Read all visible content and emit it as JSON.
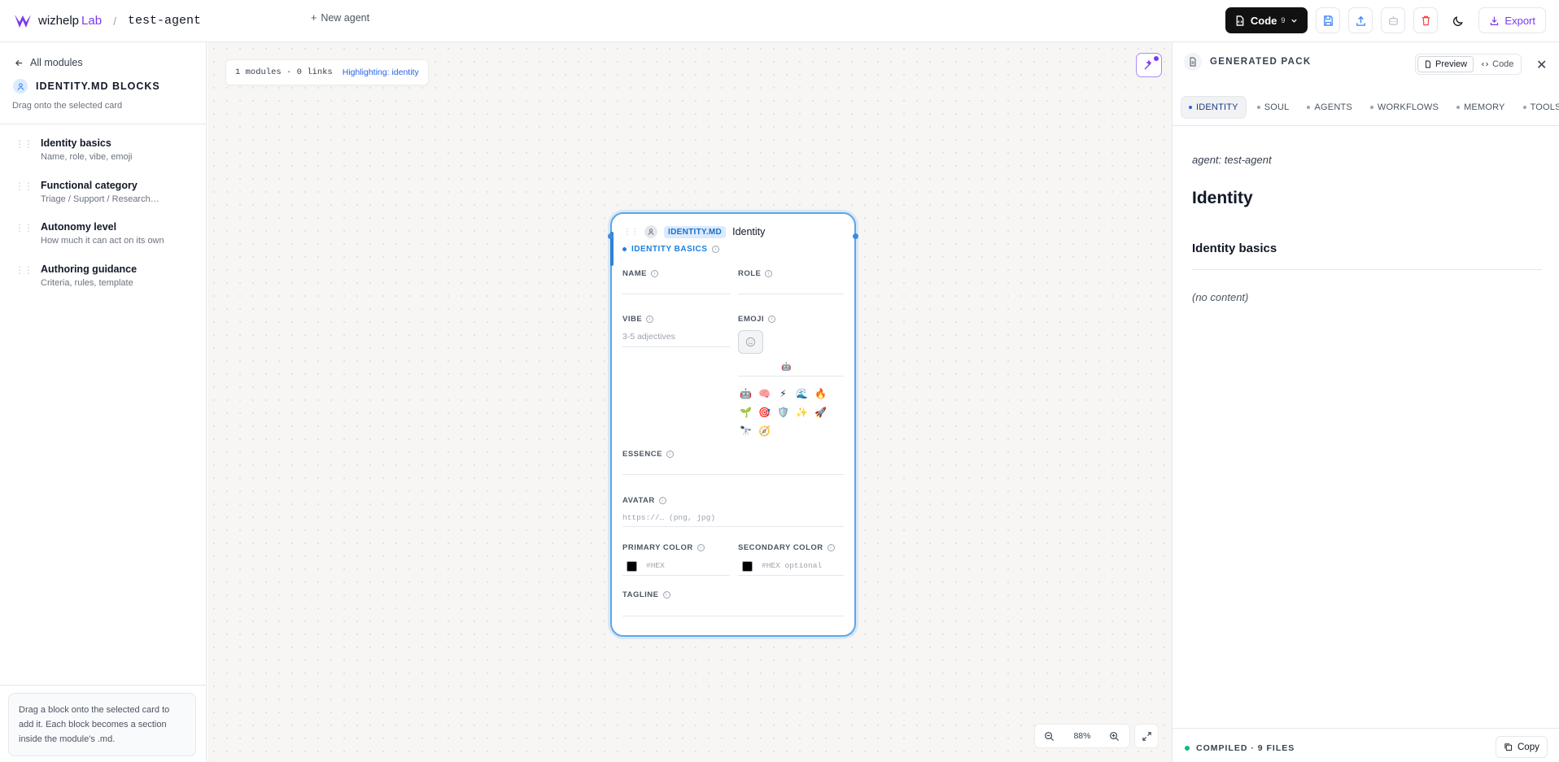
{
  "colors": {
    "accent": "#7c3aed",
    "selected": "#2f7fd8",
    "success": "#10b981"
  },
  "topbar": {
    "brand": "wizhelp",
    "brand_suffix": "Lab",
    "separator": "/",
    "agent_name": "test-agent",
    "new_agent": "New agent",
    "code_label": "Code",
    "code_count": "9",
    "export_label": "Export"
  },
  "sidebar": {
    "back_label": "All modules",
    "title": "IDENTITY.MD BLOCKS",
    "subtitle": "Drag onto the selected card",
    "items": [
      {
        "title": "Identity basics",
        "desc": "Name, role, vibe, emoji"
      },
      {
        "title": "Functional category",
        "desc": "Triage / Support / Research…"
      },
      {
        "title": "Autonomy level",
        "desc": "How much it can act on its own"
      },
      {
        "title": "Authoring guidance",
        "desc": "Criteria, rules, template"
      }
    ],
    "hint": "Drag a block onto the selected card to add it. Each block becomes a section inside the module's .md."
  },
  "canvas": {
    "summary": "1 modules · 0 links",
    "highlight": "Highlighting: identity",
    "zoom": "88%"
  },
  "card": {
    "tag": "IDENTITY.MD",
    "title": "Identity",
    "section": "IDENTITY BASICS",
    "fields": {
      "name": "NAME",
      "role": "ROLE",
      "vibe": "VIBE",
      "vibe_placeholder": "3-5 adjectives",
      "emoji": "EMOJI",
      "essence": "ESSENCE",
      "avatar": "AVATAR",
      "avatar_placeholder": "https://… (png, jpg)",
      "primary_color": "PRIMARY COLOR",
      "primary_placeholder": "#HEX",
      "secondary_color": "SECONDARY COLOR",
      "secondary_placeholder": "#HEX optional",
      "tagline": "TAGLINE"
    },
    "emoji_selected": "🤖",
    "emojis": [
      "🤖",
      "🧠",
      "⚡",
      "🌊",
      "🔥",
      "🌱",
      "🎯",
      "🛡️",
      "✨",
      "🚀",
      "🔭",
      "🧭"
    ]
  },
  "right_panel": {
    "title": "GENERATED PACK",
    "preview_label": "Preview",
    "code_label": "Code",
    "close": "✕",
    "tabs": [
      "IDENTITY",
      "SOUL",
      "AGENTS",
      "WORKFLOWS",
      "MEMORY",
      "TOOLS"
    ],
    "active_tab": "IDENTITY",
    "preview": {
      "meta": "agent: test-agent",
      "h1": "Identity",
      "h2": "Identity basics",
      "empty": "(no content)"
    },
    "footer_status": "COMPILED · 9 FILES",
    "copy_label": "Copy"
  }
}
